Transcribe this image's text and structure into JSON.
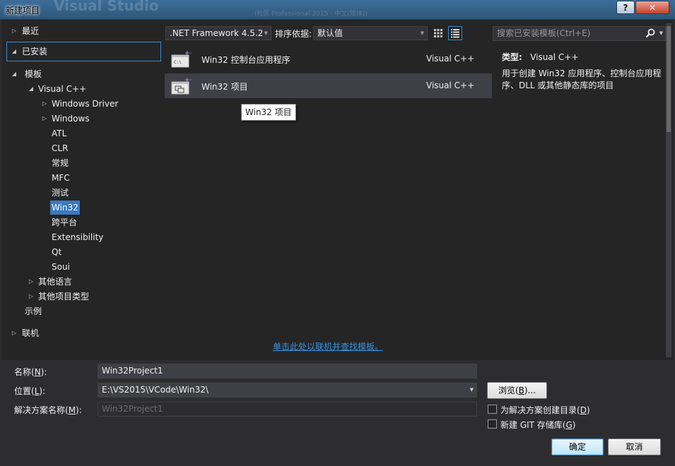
{
  "window": {
    "title": "新建项目",
    "help_glyph": "?",
    "close_glyph": "✕",
    "background_ghost": "Visual Studio",
    "background_ghost_sub": "(社区 Professional 2015 - 中文(简体))"
  },
  "tree": {
    "recent": "最近",
    "installed": "已安装",
    "templates": "模板",
    "visual_cpp": "Visual C++",
    "children": [
      "Windows Driver",
      "Windows",
      "ATL",
      "CLR",
      "常规",
      "MFC",
      "测试",
      "Win32",
      "跨平台",
      "Extensibility",
      "Qt",
      "Soui"
    ],
    "other_languages": "其他语言",
    "other_project_types": "其他项目类型",
    "samples": "示例",
    "online": "联机"
  },
  "toolbar": {
    "framework": ".NET Framework 4.5.2",
    "sort_label": "排序依据:",
    "sort_value": "默认值"
  },
  "search": {
    "placeholder": "搜索已安装模板(Ctrl+E)"
  },
  "templates": [
    {
      "name": "Win32 控制台应用程序",
      "lang": "Visual C++",
      "icon": "console-app-icon"
    },
    {
      "name": "Win32 项目",
      "lang": "Visual C++",
      "icon": "win32-project-icon"
    }
  ],
  "tooltip": "Win32 项目",
  "description": {
    "type_label": "类型:",
    "type_value": "Visual C++",
    "text": "用于创建 Win32 应用程序、控制台应用程序、DLL 或其他静态库的项目"
  },
  "online_link": "单击此处以联机并查找模板。",
  "form": {
    "name_label": "名称(",
    "name_key": "N",
    "name_label_end": "):",
    "name_value": "Win32Project1",
    "location_label": "位置(",
    "location_key": "L",
    "location_label_end": "):",
    "location_value": "E:\\VS2015\\VCode\\Win32\\",
    "solution_label": "解决方案名称(",
    "solution_key": "M",
    "solution_label_end": "):",
    "solution_value": "Win32Project1",
    "browse_label": "浏览(",
    "browse_key": "B",
    "browse_label_end": ")...",
    "create_dir_label": "为解决方案创建目录(",
    "create_dir_key": "D",
    "create_dir_end": ")",
    "git_label": "新建 GIT 存储库(",
    "git_key": "G",
    "git_end": ")",
    "ok_label": "确定",
    "cancel_label": "取消"
  },
  "colors": {
    "accent": "#3a8bd4",
    "background": "#252526",
    "link": "#3794e0"
  }
}
